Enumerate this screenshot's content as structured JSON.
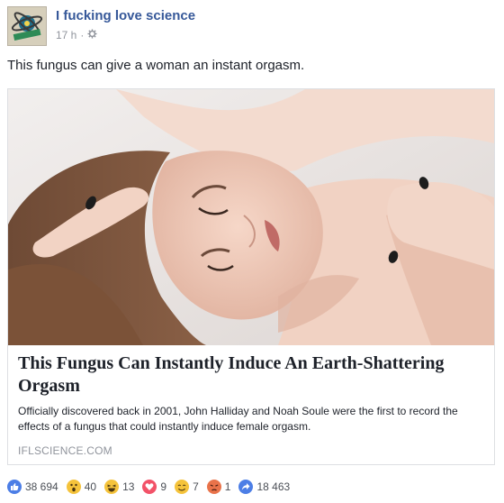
{
  "post": {
    "page_name": "I fucking love science",
    "timestamp": "17 h",
    "separator": "·",
    "privacy_icon": "gear-icon",
    "text": "This fungus can give a woman an instant orgasm."
  },
  "link_card": {
    "image_icon": "photo-woman",
    "title": "This Fungus Can Instantly Induce An Earth-Shattering Orgasm",
    "description": "Officially discovered back in 2001, John Halliday and Noah Soule were the first to record the effects of a fungus that could instantly induce female orgasm.",
    "domain": "IFLSCIENCE.COM"
  },
  "reactions": [
    {
      "icon": "like-icon",
      "count": "38 694",
      "color": "#4c7ee6"
    },
    {
      "icon": "wow-icon",
      "count": "40",
      "color": "#f5c33b"
    },
    {
      "icon": "haha-icon",
      "count": "13",
      "color": "#f5c33b"
    },
    {
      "icon": "love-icon",
      "count": "9",
      "color": "#f25268"
    },
    {
      "icon": "yay-icon",
      "count": "7",
      "color": "#f5c33b"
    },
    {
      "icon": "angry-icon",
      "count": "1",
      "color": "#e9734a"
    },
    {
      "icon": "share-icon",
      "count": "18 463",
      "color": "#4c7ee6"
    }
  ]
}
